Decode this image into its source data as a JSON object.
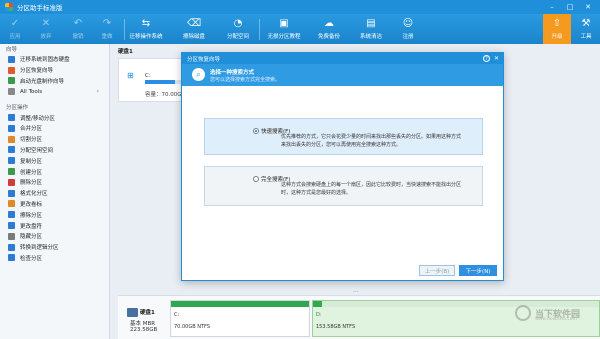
{
  "window": {
    "title": "分区助手标准版"
  },
  "toolbar": {
    "items": [
      {
        "label": "应用",
        "icon": "apply-icon",
        "glyph": "✓",
        "enabled": false
      },
      {
        "label": "放弃",
        "icon": "discard-icon",
        "glyph": "✕",
        "enabled": false
      },
      {
        "label": "撤销",
        "icon": "undo-icon",
        "glyph": "↶",
        "enabled": false
      },
      {
        "label": "重做",
        "icon": "redo-icon",
        "glyph": "↷",
        "enabled": false
      },
      {
        "label": "迁移操作系统",
        "icon": "migrate-os-icon",
        "glyph": "⇆",
        "enabled": true
      },
      {
        "label": "擦除磁盘",
        "icon": "wipe-disk-icon",
        "glyph": "⌫",
        "enabled": true
      },
      {
        "label": "分配空间",
        "icon": "allocate-space-icon",
        "glyph": "◔",
        "enabled": true
      },
      {
        "label": "无损分区教程",
        "icon": "tutorial-icon",
        "glyph": "▣",
        "enabled": true
      },
      {
        "label": "免费备份",
        "icon": "backup-icon",
        "glyph": "☁",
        "enabled": true
      },
      {
        "label": "系统清洁",
        "icon": "system-clean-icon",
        "glyph": "▤",
        "enabled": true
      },
      {
        "label": "注册",
        "icon": "register-icon",
        "glyph": "☺",
        "enabled": true
      }
    ],
    "upgrade": {
      "label": "升级",
      "icon": "upgrade-icon",
      "glyph": "⇧"
    },
    "tools": {
      "label": "工具",
      "icon": "tools-icon",
      "glyph": "⚒"
    }
  },
  "sidebar": {
    "wizard_header": "向导",
    "wizard_items": [
      {
        "label": "迁移系统到固态硬盘",
        "color": "#2e7bd6"
      },
      {
        "label": "分区恢复向导",
        "color": "#e05a2a"
      },
      {
        "label": "启动光盘制作向导",
        "color": "#3a9a4a"
      },
      {
        "label": "All Tools",
        "color": "#888888",
        "more": true
      }
    ],
    "ops_header": "分区操作",
    "ops_items": [
      {
        "label": "调整/移动分区",
        "color": "#2e7bd6"
      },
      {
        "label": "合并分区",
        "color": "#2e7bd6"
      },
      {
        "label": "切割分区",
        "color": "#e0892a"
      },
      {
        "label": "分配空闲空间",
        "color": "#2e7bd6"
      },
      {
        "label": "复制分区",
        "color": "#2e7bd6"
      },
      {
        "label": "创建分区",
        "color": "#3a9a4a"
      },
      {
        "label": "删除分区",
        "color": "#d33a3a"
      },
      {
        "label": "格式化分区",
        "color": "#2e7bd6"
      },
      {
        "label": "更改卷标",
        "color": "#e0892a"
      },
      {
        "label": "擦除分区",
        "color": "#2e7bd6"
      },
      {
        "label": "更改盘符",
        "color": "#2e7bd6"
      },
      {
        "label": "隐藏分区",
        "color": "#7a7a7a"
      },
      {
        "label": "转换到逻辑分区",
        "color": "#2e7bd6"
      },
      {
        "label": "检查分区",
        "color": "#2e7bd6"
      }
    ]
  },
  "main": {
    "disk_label": "硬盘1",
    "disk_card": {
      "drive": "C:",
      "capacity": "容量：70.00GB",
      "used_fraction": 0.6
    }
  },
  "dialog": {
    "title": "分区恢复向导",
    "banner_title": "选择一种搜索方式",
    "banner_subtitle": "您可以选择搜索方式完全搜索。",
    "option_fast": {
      "label": "快速搜索(F)",
      "desc1": "优先推荐的方式，它只会花费少量的时间来找出那些丢失的分区。如果用这种方式",
      "desc2": "来找出丢失的分区，您可以再使用完全搜索这种方式。",
      "selected": true
    },
    "option_full": {
      "label": "完全搜索(F)",
      "desc1": "这种方式会搜索硬盘上的每一个扇区，因此它比较费时，当快速搜索不能找出分区",
      "desc2": "时，这种方式是您最好的选择。",
      "selected": false
    },
    "prev_label": "上一步(B)",
    "next_label": "下一步(N)"
  },
  "bottom": {
    "disk_name": "硬盘1",
    "disk_type": "基本 MBR",
    "disk_size": "223.58GB",
    "partitions": [
      {
        "label": "C:",
        "info": "70.00GB NTFS",
        "color": "#2fa84f"
      },
      {
        "label": "D:",
        "info": "153.58GB NTFS",
        "color": "#2b8a3e"
      }
    ]
  },
  "watermark": {
    "text": "当下软件园",
    "sub": "www.downxia.com"
  }
}
